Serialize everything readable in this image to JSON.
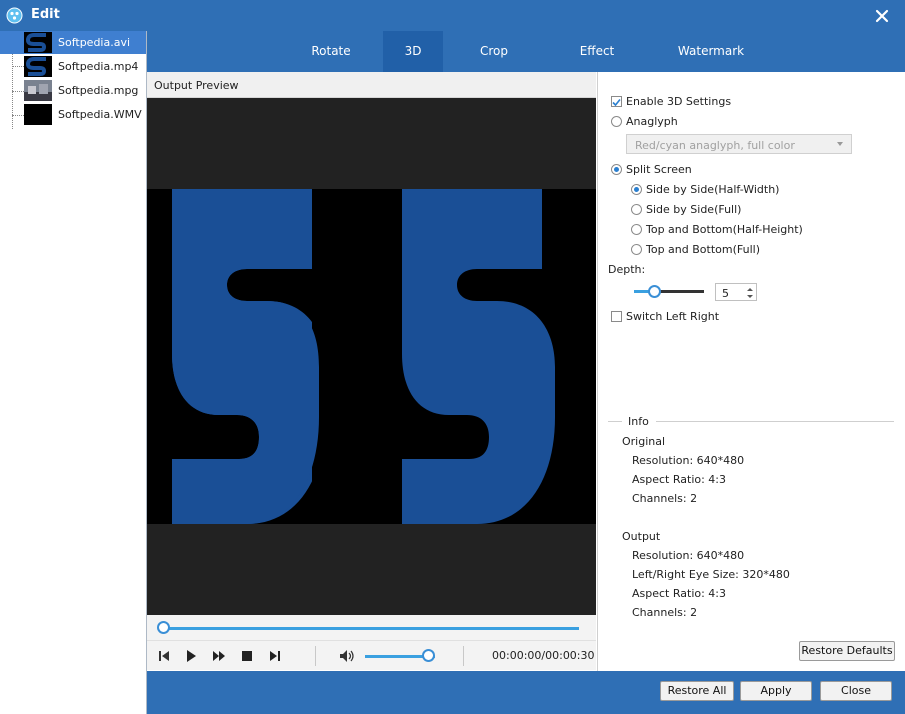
{
  "window": {
    "title": "Edit"
  },
  "files": [
    {
      "name": "Softpedia.avi"
    },
    {
      "name": "Softpedia.mp4"
    },
    {
      "name": "Softpedia.mpg"
    },
    {
      "name": "Softpedia.WMV"
    }
  ],
  "tabs": [
    {
      "label": "Rotate"
    },
    {
      "label": "3D"
    },
    {
      "label": "Crop"
    },
    {
      "label": "Effect"
    },
    {
      "label": "Watermark"
    }
  ],
  "preview": {
    "header": "Output Preview",
    "timecode": "00:00:00/00:00:30",
    "seek_progress": 0,
    "volume_level": 0.9
  },
  "settings": {
    "enable_3d": {
      "label": "Enable 3D Settings",
      "checked": true
    },
    "anaglyph": {
      "label": "Anaglyph",
      "selected": false
    },
    "anaglyph_dropdown": {
      "value": "Red/cyan anaglyph, full color"
    },
    "split_screen": {
      "label": "Split Screen",
      "selected": true
    },
    "split_options": [
      {
        "label": "Side by Side(Half-Width)",
        "selected": true
      },
      {
        "label": "Side by Side(Full)",
        "selected": false
      },
      {
        "label": "Top and Bottom(Half-Height)",
        "selected": false
      },
      {
        "label": "Top and Bottom(Full)",
        "selected": false
      }
    ],
    "depth": {
      "label": "Depth:",
      "value": "5"
    },
    "switch_lr": {
      "label": "Switch Left Right",
      "checked": false
    }
  },
  "info": {
    "title": "Info",
    "original": {
      "heading": "Original",
      "resolution": "Resolution: 640*480",
      "aspect": "Aspect Ratio: 4:3",
      "channels": "Channels: 2"
    },
    "output": {
      "heading": "Output",
      "resolution": "Resolution: 640*480",
      "eye_size": "Left/Right Eye Size: 320*480",
      "aspect": "Aspect Ratio: 4:3",
      "channels": "Channels: 2"
    }
  },
  "buttons": {
    "restore_defaults": "Restore Defaults",
    "restore_all": "Restore All",
    "apply": "Apply",
    "close": "Close"
  },
  "colors": {
    "titlebar": "#2f6fb5",
    "tab_active": "#2160a8",
    "accent": "#3aa0e0",
    "logo_blue": "#1a4f96"
  }
}
